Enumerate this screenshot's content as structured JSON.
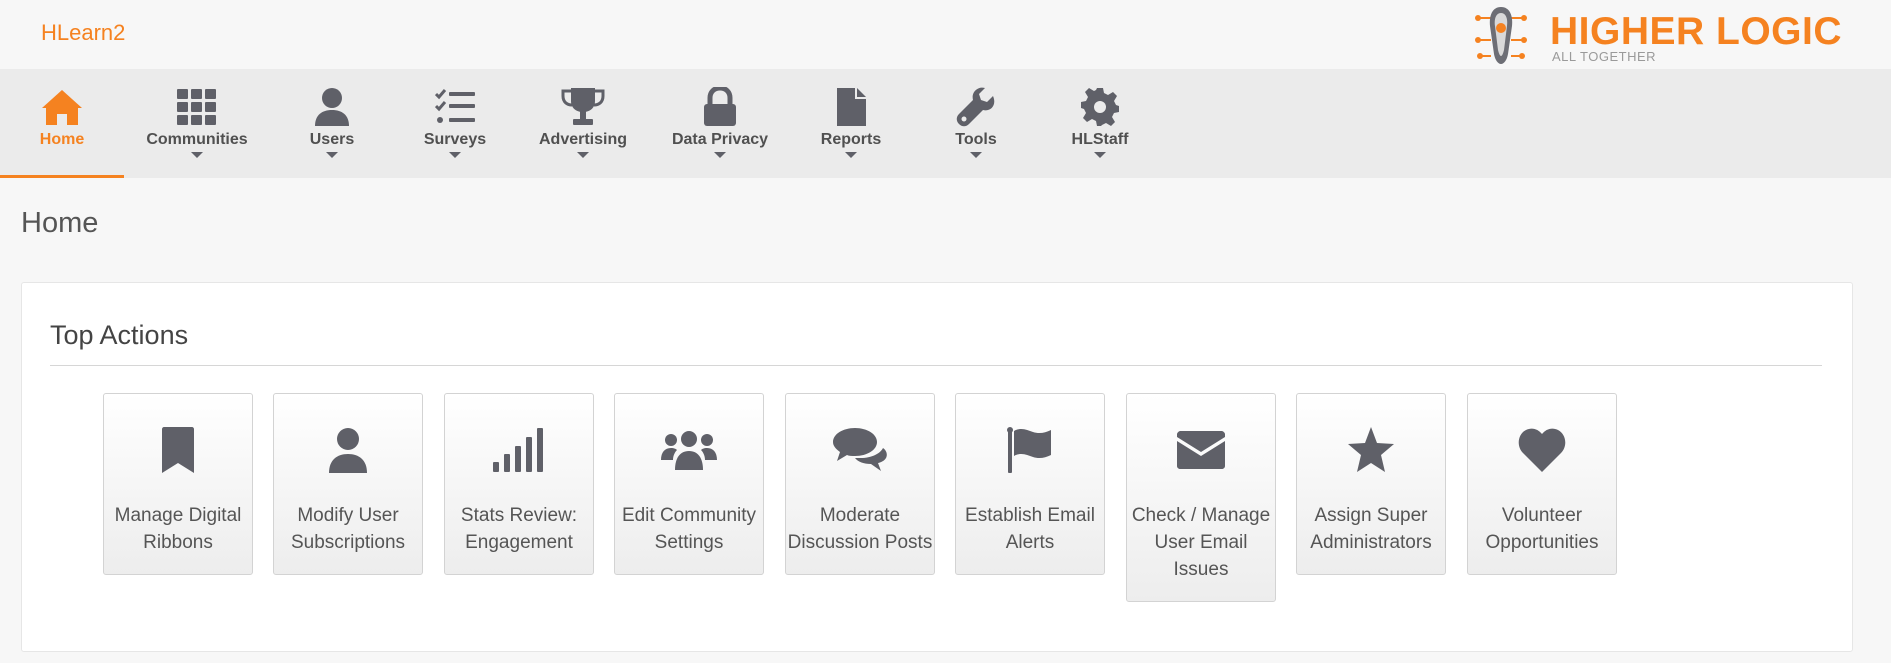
{
  "header": {
    "site_name": "HLearn2",
    "logo_word": "HIGHER LOGIC",
    "logo_tagline": "ALL TOGETHER"
  },
  "nav": {
    "items": [
      {
        "label": "Home",
        "icon": "home-icon",
        "active": true,
        "has_dropdown": false
      },
      {
        "label": "Communities",
        "icon": "grid-icon",
        "has_dropdown": true
      },
      {
        "label": "Users",
        "icon": "user-icon",
        "has_dropdown": true
      },
      {
        "label": "Surveys",
        "icon": "checklist-icon",
        "has_dropdown": true
      },
      {
        "label": "Advertising",
        "icon": "trophy-icon",
        "has_dropdown": true
      },
      {
        "label": "Data Privacy",
        "icon": "lock-icon",
        "has_dropdown": true
      },
      {
        "label": "Reports",
        "icon": "file-icon",
        "has_dropdown": true
      },
      {
        "label": "Tools",
        "icon": "wrench-icon",
        "has_dropdown": true
      },
      {
        "label": "HLStaff",
        "icon": "gear-icon",
        "has_dropdown": true
      }
    ]
  },
  "page": {
    "title": "Home"
  },
  "top_actions": {
    "title": "Top Actions",
    "tiles": [
      {
        "line1": "Manage Digital",
        "line2": "Ribbons",
        "icon": "bookmark-icon"
      },
      {
        "line1": "Modify User",
        "line2": "Subscriptions",
        "icon": "user-icon"
      },
      {
        "line1": "Stats Review:",
        "line2": "Engagement",
        "icon": "signal-bars-icon"
      },
      {
        "line1": "Edit Community",
        "line2": "Settings",
        "icon": "users-group-icon"
      },
      {
        "line1": "Moderate",
        "line2": "Discussion Posts",
        "icon": "comments-icon"
      },
      {
        "line1": "Establish Email",
        "line2": "Alerts",
        "icon": "flag-icon"
      },
      {
        "line1": "Check / Manage",
        "line2": "User Email",
        "line3": "Issues",
        "icon": "envelope-icon"
      },
      {
        "line1": "Assign Super",
        "line2": "Administrators",
        "icon": "star-icon"
      },
      {
        "line1": "Volunteer",
        "line2": "Opportunities",
        "icon": "heart-icon"
      }
    ]
  },
  "colors": {
    "accent": "#f58220",
    "icon": "#5f6068",
    "nav_bg": "#ebebeb",
    "page_bg": "#f7f7f7"
  }
}
